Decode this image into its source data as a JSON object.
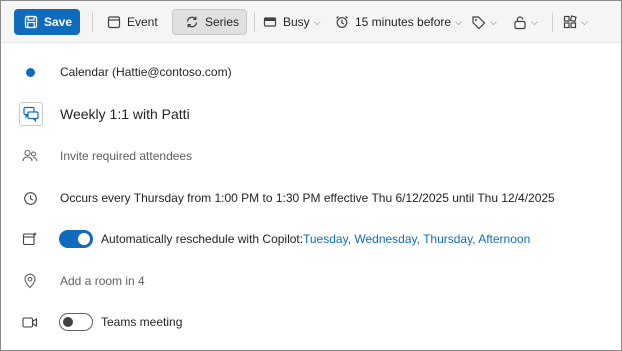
{
  "toolbar": {
    "save_label": "Save",
    "event_label": "Event",
    "series_label": "Series",
    "busy_label": "Busy",
    "reminder_label": "15 minutes before"
  },
  "calendar": {
    "label": "Calendar (Hattie@contoso.com)",
    "color": "#0f6cbd"
  },
  "title": {
    "value": "Weekly 1:1 with Patti"
  },
  "attendees": {
    "placeholder": "Invite required attendees"
  },
  "recurrence": {
    "text": "Occurs every Thursday from 1:00 PM to 1:30 PM effective Thu 6/12/2025 until Thu 12/4/2025"
  },
  "reschedule": {
    "enabled": true,
    "label": "Automatically reschedule with Copilot:",
    "link": "Tuesday, Wednesday, Thursday, Afternoon"
  },
  "location": {
    "placeholder": "Add a room in 4"
  },
  "teams": {
    "enabled": false,
    "label": "Teams meeting"
  },
  "colors": {
    "accent": "#0f6cbd",
    "toolbar_bg": "#f5f5f5"
  }
}
